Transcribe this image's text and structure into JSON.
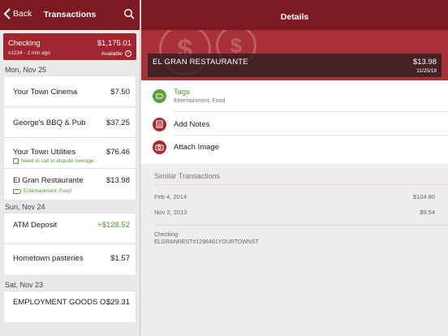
{
  "left": {
    "back_label": "Back",
    "title": "Transactions",
    "account": {
      "name": "Checking",
      "balance": "$1,175.01",
      "sub": "x1234 - 2 min ago",
      "available": "Available"
    },
    "groups": [
      {
        "date": "Mon, Nov 25",
        "rows": [
          {
            "merchant": "Your Town Cinema",
            "amount": "$7.50"
          },
          {
            "merchant": "George's BBQ & Pub",
            "amount": "$37.25"
          },
          {
            "merchant": "Your Town Utilities",
            "amount": "$76.46",
            "note": "Need to call to dispute overage."
          },
          {
            "merchant": "El Gran Restaurante",
            "amount": "$13.98",
            "tags": "Entertainment, Food"
          }
        ]
      },
      {
        "date": "Sun, Nov 24",
        "rows": [
          {
            "merchant": "ATM Deposit",
            "amount": "+$128.52"
          },
          {
            "merchant": "Hometown pasteries",
            "amount": "$1.57"
          }
        ]
      },
      {
        "date": "Sat, Nov 23",
        "rows": [
          {
            "merchant": "EMPLOYMENT GOODS O...",
            "amount": "$29.31"
          }
        ]
      }
    ]
  },
  "right": {
    "title": "Details",
    "merchant": "EL GRAN RESTAURANTE",
    "amount": "$13.98",
    "date": "11/25/18",
    "tags_label": "Tags",
    "tags_value": "Entertainment, Food",
    "add_notes_label": "Add Notes",
    "attach_image_label": "Attach Image",
    "similar_heading": "Similar Transactions",
    "similar": [
      {
        "date": "Feb 4, 2014",
        "amount": "$104.80"
      },
      {
        "date": "Nov 2, 2013",
        "amount": "$9.54"
      }
    ],
    "account_name": "Checking",
    "account_desc": "ELGRANREST#1298461YOURTOWNST"
  },
  "colors": {
    "nav": "#7c1a21",
    "accent": "#a02630",
    "positive": "#4a9c2e"
  },
  "icons": [
    "back-chevron-icon",
    "search-icon",
    "info-icon",
    "tag-icon",
    "notes-icon",
    "camera-icon",
    "dollar-coin-icon"
  ]
}
